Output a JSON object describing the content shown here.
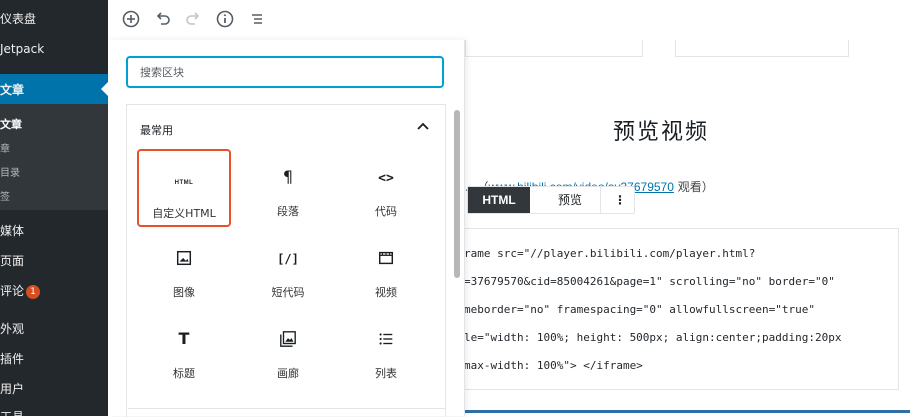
{
  "sidebar": {
    "items": [
      {
        "label": "仪表盘"
      },
      {
        "label": "Jetpack"
      },
      {
        "label": "文章"
      },
      {
        "label": "媒体"
      },
      {
        "label": "页面"
      },
      {
        "label": "评论",
        "badge": "1"
      },
      {
        "label": "外观"
      },
      {
        "label": "插件"
      },
      {
        "label": "用户"
      },
      {
        "label": "工具"
      }
    ],
    "sub_items": [
      "文章",
      "章",
      "目录",
      "签"
    ]
  },
  "toolbar": {
    "icons": [
      "add-block-icon",
      "undo-icon",
      "redo-icon",
      "info-icon",
      "block-navigation-icon"
    ]
  },
  "inserter": {
    "search_placeholder": "搜索区块",
    "panel_title": "最常用",
    "blocks": [
      {
        "label": "自定义HTML",
        "icon": "html-icon",
        "icon_text": "HTML",
        "selected": true
      },
      {
        "label": "段落",
        "icon": "paragraph-icon",
        "icon_text": "¶"
      },
      {
        "label": "代码",
        "icon": "code-icon",
        "icon_text": "<>"
      },
      {
        "label": "图像",
        "icon": "image-icon"
      },
      {
        "label": "短代码",
        "icon": "shortcode-icon",
        "icon_text": "[/]"
      },
      {
        "label": "视频",
        "icon": "video-icon"
      },
      {
        "label": "标题",
        "icon": "heading-icon",
        "icon_text": "T"
      },
      {
        "label": "画廊",
        "icon": "gallery-icon"
      },
      {
        "label": "列表",
        "icon": "list-icon"
      }
    ]
  },
  "content": {
    "heading": "预览视频",
    "paragraph_prefix": "...（",
    "paragraph_link": "www.bilibili.com/video/av37679570",
    "paragraph_suffix": " 观看）",
    "html_block": {
      "tab_html": "HTML",
      "tab_preview": "预览",
      "more": "⋮"
    },
    "code_lines": [
      "rame src=\"//player.bilibili.com/player.html?",
      "=37679570&cid=85004261&page=1\" scrolling=\"no\" border=\"0\"",
      "meborder=\"no\" framespacing=\"0\" allowfullscreen=\"true\"",
      "le=\"width: 100%; height: 500px; align:center;padding:20px",
      "max-width: 100%\"> </iframe>"
    ]
  },
  "colors": {
    "sidebar_bg": "#23282d",
    "active_menu": "#0073aa",
    "search_border": "#00a0d2",
    "selected_block_border": "#e6512a",
    "link": "#0073aa"
  }
}
